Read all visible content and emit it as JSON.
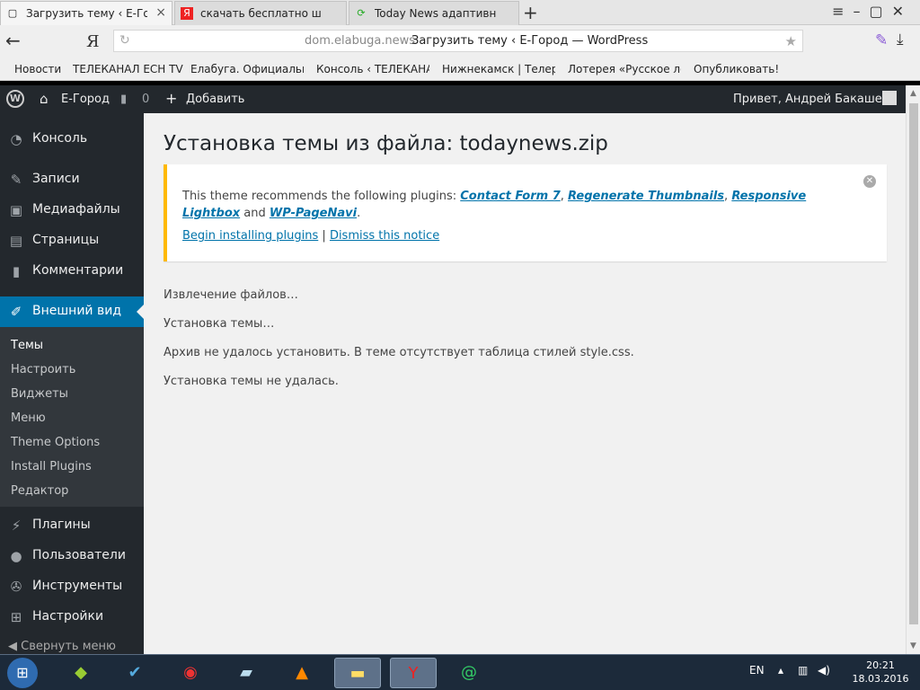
{
  "browser": {
    "tabs": [
      {
        "title": "Загрузить тему ‹ Е-Город",
        "favicon": "page-icon",
        "active": true
      },
      {
        "title": "скачать бесплатно шаблон т",
        "favicon": "yandex-icon",
        "active": false
      },
      {
        "title": "Today News адаптивный шаб",
        "favicon": "refresh-icon",
        "active": false
      }
    ],
    "new_tab": "+",
    "yandex_logo": "Я",
    "url_domain": "dom.elabuga.news",
    "url_title": "Загрузить тему ‹ Е-Город — WordPress",
    "bookmarks": [
      "Новости",
      "ТЕЛЕКАНАЛ ЕСН TV",
      "Елабуга. Официальны",
      "Консоль ‹ ТЕЛЕКАНА",
      "Нижнекамск | Телера",
      "Лотерея «Русское ло",
      "Опубликовать!"
    ]
  },
  "adminbar": {
    "site_name": "Е-Город",
    "comments_count": "0",
    "add_new": "Добавить",
    "greeting": "Привет, Андрей Бакашев"
  },
  "sidebar": {
    "items": [
      {
        "label": "Консоль",
        "icon": "dashboard-icon"
      },
      {
        "label": "Записи",
        "icon": "pin-icon"
      },
      {
        "label": "Медиафайлы",
        "icon": "media-icon"
      },
      {
        "label": "Страницы",
        "icon": "pages-icon"
      },
      {
        "label": "Комментарии",
        "icon": "comment-icon"
      },
      {
        "label": "Внешний вид",
        "icon": "brush-icon",
        "current": true
      },
      {
        "label": "Плагины",
        "icon": "plugin-icon"
      },
      {
        "label": "Пользователи",
        "icon": "user-icon"
      },
      {
        "label": "Инструменты",
        "icon": "wrench-icon"
      },
      {
        "label": "Настройки",
        "icon": "settings-icon"
      }
    ],
    "submenu": [
      "Темы",
      "Настроить",
      "Виджеты",
      "Меню",
      "Theme Options",
      "Install Plugins",
      "Редактор"
    ],
    "collapse": "Свернуть меню"
  },
  "main": {
    "title": "Установка темы из файла: todaynews.zip",
    "notice": {
      "text_before": "This theme recommends the following plugins: ",
      "plugins": [
        "Contact Form 7",
        "Regenerate Thumbnails",
        "Responsive Lightbox",
        "WP-PageNavi"
      ],
      "sep1": ", ",
      "and": " and ",
      "end": ".",
      "begin_link": "Begin installing plugins",
      "divider": " | ",
      "dismiss_link": "Dismiss this notice"
    },
    "messages": [
      "Извлечение файлов…",
      "Установка темы…",
      "Архив не удалось установить. В теме отсутствует таблица стилей style.css.",
      "Установка темы не удалась."
    ]
  },
  "taskbar": {
    "lang": "EN",
    "time": "20:21",
    "date": "18.03.2016"
  },
  "colors": {
    "admin_dark": "#23282d",
    "accent_blue": "#0073aa",
    "notice_yellow": "#ffb900"
  }
}
